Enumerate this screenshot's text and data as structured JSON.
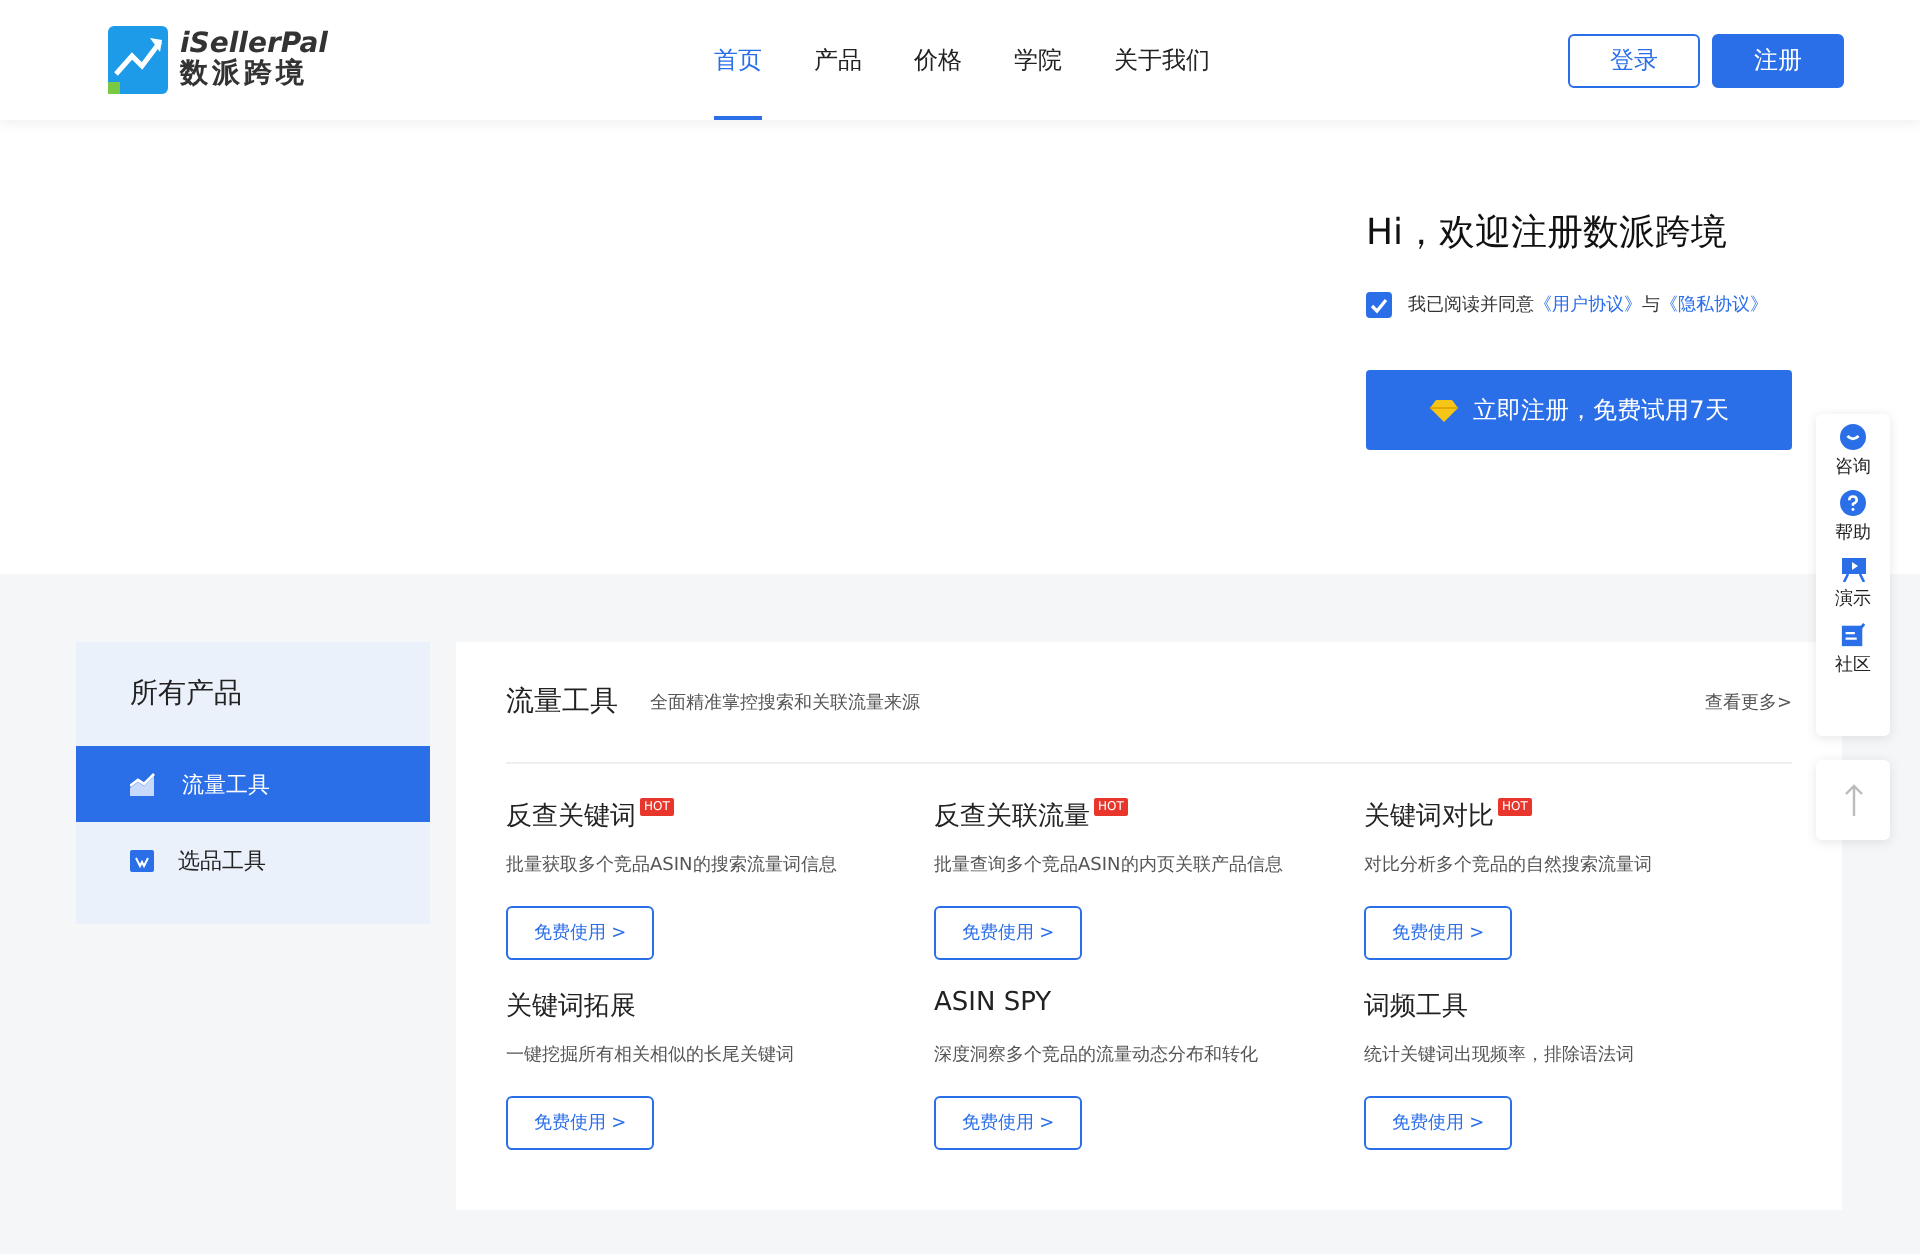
{
  "header": {
    "logo_name": "iSellerPal",
    "logo_cn": "数派跨境",
    "nav": [
      {
        "label": "首页",
        "selected": true
      },
      {
        "label": "产品",
        "selected": false
      },
      {
        "label": "价格",
        "selected": false
      },
      {
        "label": "学院",
        "selected": false
      },
      {
        "label": "关于我们",
        "selected": false
      }
    ],
    "login": "登录",
    "register": "注册"
  },
  "hero": {
    "title": "Hi，欢迎注册数派跨境",
    "agree": {
      "checked": true,
      "text": "我已阅读并同意",
      "link1": "《用户协议》",
      "and": "与",
      "link2": "《隐私协议》"
    },
    "cta": "立即注册，免费试用7天"
  },
  "float_menu": [
    {
      "kind": "chat",
      "label": "咨询"
    },
    {
      "kind": "help",
      "label": "帮助"
    },
    {
      "kind": "demo",
      "label": "演示"
    },
    {
      "kind": "community",
      "label": "社区"
    }
  ],
  "sidebar": {
    "title": "所有产品",
    "items": [
      {
        "kind": "traffic",
        "label": "流量工具",
        "selected": true
      },
      {
        "kind": "select",
        "label": "选品工具",
        "selected": false
      }
    ]
  },
  "section": {
    "title": "流量工具",
    "subtitle": "全面精准掌控搜索和关联流量来源",
    "more": "查看更多>",
    "tools": [
      {
        "name": "反查关键词",
        "hot": "HOT",
        "desc": "批量获取多个竞品ASIN的搜索流量词信息",
        "button": "免费使用 >"
      },
      {
        "name": "反查关联流量",
        "hot": "HOT",
        "desc": "批量查询多个竞品ASIN的内页关联产品信息",
        "button": "免费使用 >"
      },
      {
        "name": "关键词对比",
        "hot": "HOT",
        "desc": "对比分析多个竞品的自然搜索流量词",
        "button": "免费使用 >"
      },
      {
        "name": "关键词拓展",
        "desc": "一键挖掘所有相关相似的长尾关键词",
        "button": "免费使用 >"
      },
      {
        "name": "ASIN SPY",
        "desc": "深度洞察多个竞品的流量动态分布和转化",
        "button": "免费使用 >"
      },
      {
        "name": "词频工具",
        "desc": "统计关键词出现频率，排除语法词",
        "button": "免费使用 >"
      }
    ]
  }
}
